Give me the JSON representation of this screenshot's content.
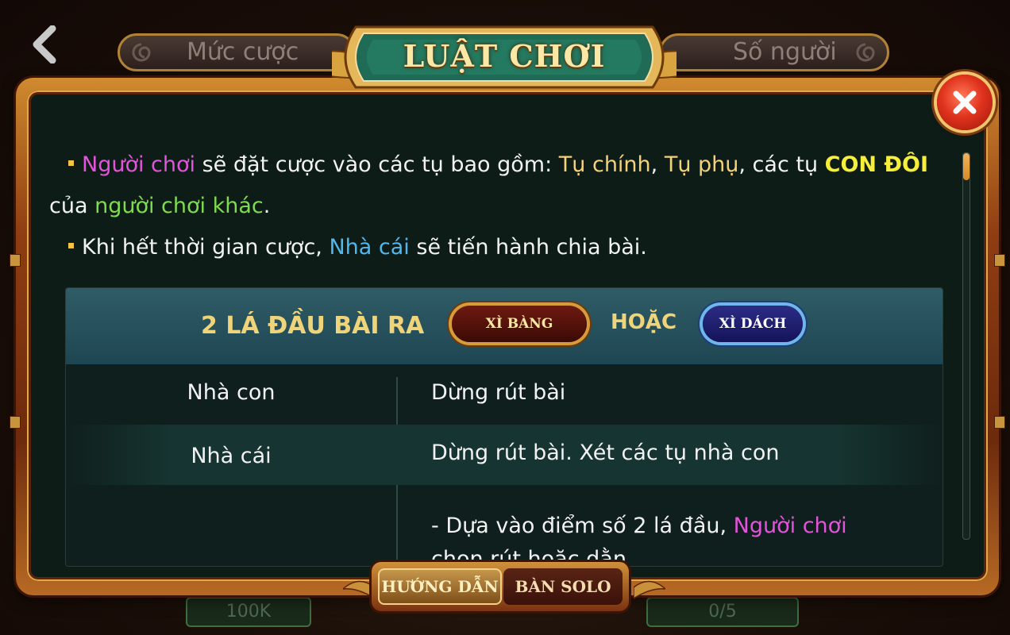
{
  "header": {
    "back_icon": "chevron-left-icon",
    "tab_left_label": "Mức cược",
    "tab_right_label": "Số người",
    "title": "LUẬT CHƠI",
    "close_icon": "close-x-icon"
  },
  "rules": {
    "p1_seg1": "Người chơi",
    "p1_seg2": " sẽ đặt cược vào các tụ bao gồm: ",
    "p1_seg3": "Tụ chính",
    "p1_seg4": ", ",
    "p1_seg5": "Tụ phụ",
    "p1_seg6": ", các tụ ",
    "p1_seg7": "CON ĐÔI",
    "p2_seg1": "của ",
    "p2_seg2": "người chơi khác",
    "p2_seg3": ".",
    "p3_seg1": "Khi hết thời gian cược, ",
    "p3_seg2": "Nhà cái",
    "p3_seg3": " sẽ tiến hành chia bài."
  },
  "table": {
    "header_label": "2 LÁ ĐẦU BÀI RA",
    "badge_1": "XÌ BÀNG",
    "or_label": "HOẶC",
    "badge_2": "XÌ DÁCH",
    "rows": [
      {
        "left": "Nhà con",
        "right": "Dừng rút bài"
      },
      {
        "left": "Nhà cái",
        "right": "Dừng rút bài. Xét các tụ nhà con"
      },
      {
        "left": "",
        "right_seg1": "- Dựa vào điểm số 2 lá đầu, ",
        "right_seg2": "Người chơi",
        "right_line2": "chọn rút hoặc dằn"
      }
    ]
  },
  "bottom_tabs": {
    "guide_label": "HƯỚNG DẪN",
    "solo_label": "BÀN SOLO",
    "active": "HƯỚNG DẪN"
  },
  "background": {
    "left_value": "100K",
    "right_value": "0/5"
  },
  "colors": {
    "highlight_pink": "#e254d9",
    "highlight_yellow": "#f3d27a",
    "highlight_bold_yellow": "#f6ee3a",
    "highlight_green": "#7fdc4f",
    "highlight_blue": "#4fb8ee",
    "table_header_text": "#f0d47a"
  }
}
